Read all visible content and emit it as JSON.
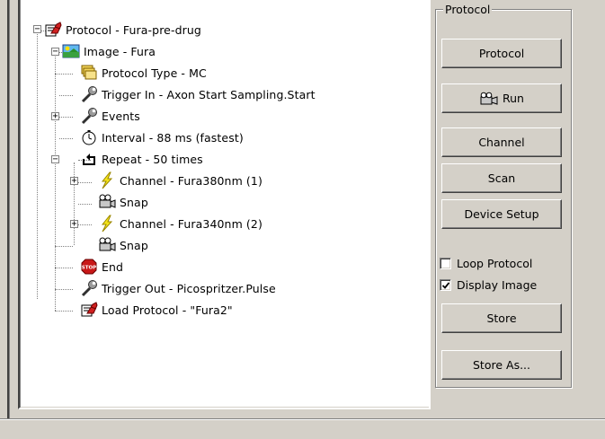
{
  "tree": {
    "items": [
      {
        "label": "Protocol - Fura-pre-drug",
        "icon": "protocol-hand-icon"
      },
      {
        "label": "Image - Fura",
        "icon": "image-icon"
      },
      {
        "label": "Protocol Type - MC",
        "icon": "stack-icon"
      },
      {
        "label": "Trigger In - Axon Start Sampling.Start",
        "icon": "trigger-wrench-icon"
      },
      {
        "label": "Events",
        "icon": "trigger-wrench-icon"
      },
      {
        "label": "Interval - 88 ms (fastest)",
        "icon": "stopwatch-icon"
      },
      {
        "label": "Repeat - 50 times",
        "icon": "repeat-icon"
      },
      {
        "label": "Channel - Fura380nm (1)",
        "icon": "lightning-icon"
      },
      {
        "label": "Snap",
        "icon": "camera-icon"
      },
      {
        "label": "Channel - Fura340nm (2)",
        "icon": "lightning-icon"
      },
      {
        "label": "Snap",
        "icon": "camera-icon"
      },
      {
        "label": "End",
        "icon": "stop-sign-icon"
      },
      {
        "label": "Trigger Out - Picospritzer.Pulse",
        "icon": "trigger-wrench-icon"
      },
      {
        "label": "Load Protocol - \"Fura2\"",
        "icon": "protocol-hand-icon"
      }
    ],
    "expander_collapsed": "+",
    "expander_expanded": "−"
  },
  "panel": {
    "group_title": "Protocol",
    "buttons": {
      "protocol": "Protocol",
      "run": "Run",
      "channel": "Channel",
      "scan": "Scan",
      "device_setup": "Device Setup",
      "store": "Store",
      "store_as": "Store As..."
    },
    "checkboxes": {
      "loop_protocol": {
        "label": "Loop Protocol",
        "checked": false
      },
      "display_image": {
        "label": "Display Image",
        "checked": true
      }
    }
  },
  "colors": {
    "face": "#d4d0c8",
    "tree_bg": "#ffffff",
    "shadow": "#808080"
  }
}
